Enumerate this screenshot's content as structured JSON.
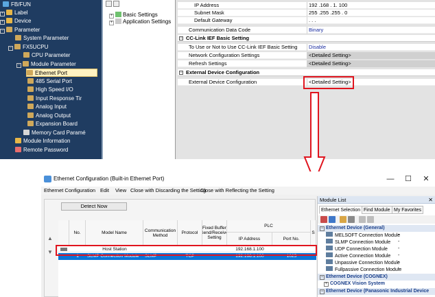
{
  "project_tree": {
    "items": [
      {
        "label": "FB/FUN"
      },
      {
        "label": "Label"
      },
      {
        "label": "Device"
      },
      {
        "label": "Parameter"
      },
      {
        "label": "System Parameter"
      },
      {
        "label": "FX5UCPU"
      },
      {
        "label": "CPU Parameter"
      },
      {
        "label": "Module Parameter"
      },
      {
        "label": "Ethernet Port"
      },
      {
        "label": "485 Serial Port"
      },
      {
        "label": "High Speed I/O"
      },
      {
        "label": "Input Response Tir"
      },
      {
        "label": "Analog Input"
      },
      {
        "label": "Analog Output"
      },
      {
        "label": "Expansion Board"
      },
      {
        "label": "Memory Card Paramé"
      },
      {
        "label": "Module Information"
      },
      {
        "label": "Remote Password"
      }
    ]
  },
  "setting_items_tree": {
    "items": [
      {
        "label": "Basic Settings"
      },
      {
        "label": "Application Settings"
      }
    ]
  },
  "parameters": {
    "rows": [
      {
        "name": "IP Address",
        "value": "192 .168 . 1. 100",
        "kind": "item"
      },
      {
        "name": "Subnet Mask",
        "value": "255 .255 .255 . 0",
        "kind": "item"
      },
      {
        "name": "Default Gateway",
        "value": ". . .",
        "kind": "item"
      },
      {
        "name": "Communication Data Code",
        "value": "Binary",
        "kind": "item",
        "blue": true
      },
      {
        "name": "CC-Link IEF Basic Setting",
        "value": "",
        "kind": "section"
      },
      {
        "name": "To Use or Not to Use CC-Link IEF Basic Setting",
        "value": "Disable",
        "kind": "item",
        "blue": true
      },
      {
        "name": "Network Configuration Settings",
        "value": "<Detailed Setting>",
        "kind": "item",
        "gray": true
      },
      {
        "name": "Refresh Settings",
        "value": "<Detailed Setting>",
        "kind": "item",
        "gray": true
      },
      {
        "name": "External Device Configuration",
        "value": "",
        "kind": "section"
      },
      {
        "name": "External Device Configuration",
        "value": "<Detailed Setting>",
        "kind": "item"
      }
    ]
  },
  "window": {
    "title": "Ethernet Configuration (Built-in Ethernet Port)",
    "controls": {
      "minimize": "—",
      "maximize": "☐",
      "close": "✕"
    },
    "menu": [
      {
        "label": "Ethernet Configuration"
      },
      {
        "label": "Edit"
      },
      {
        "label": "View"
      },
      {
        "label": "Close with Discarding the Setting"
      },
      {
        "label": "Close with Reflecting the Setting"
      }
    ],
    "detect_now": "Detect Now",
    "table": {
      "headers": {
        "no": "No.",
        "model": "Model Name",
        "comm": "Communication Method",
        "protocol": "Protocol",
        "fixed": "Fixed Buffer Send/Receive Setting",
        "plc": "PLC",
        "ip": "IP Address",
        "port": "Port No.",
        "extra": "S"
      },
      "host_row": {
        "model": "Host Station",
        "ip": "192.168.1.100"
      },
      "rows": [
        {
          "no": "1",
          "model": "SLMP Connection Module",
          "comm": "SLMP",
          "protocol": "TCP",
          "fixed": "",
          "ip": "192.168.1.100",
          "port": "1025"
        }
      ]
    }
  },
  "module_list": {
    "title": "Module List",
    "close": "✕",
    "tabs": [
      {
        "label": "Ethernet Selection"
      },
      {
        "label": "Find Module"
      },
      {
        "label": "My Favorites"
      }
    ],
    "groups": [
      {
        "label": "Ethernet Device (General)",
        "expanded": true,
        "items": [
          {
            "label": "MELSOFT Connection Module",
            "value": "-"
          },
          {
            "label": "SLMP Connection Module",
            "value": "-"
          },
          {
            "label": "UDP Connection Module",
            "value": "-"
          },
          {
            "label": "Active Connection Module",
            "value": "-"
          },
          {
            "label": "Unpassive Connection Module",
            "value": "-"
          },
          {
            "label": "Fullpassive Connection Module",
            "value": "-"
          }
        ]
      },
      {
        "label": "Ethernet Device (COGNEX)",
        "expanded": false,
        "items": []
      },
      {
        "label": "COGNEX Vision System",
        "expanded": false,
        "items": []
      },
      {
        "label": "Ethernet Device (Panasonic Industrial Device",
        "expanded": false,
        "items": []
      }
    ]
  },
  "colors": {
    "tree_bg": "#1f3c61",
    "selection_blue": "#0a74d6",
    "highlight_red": "#e0141e",
    "value_blue": "#1a2ca0"
  }
}
